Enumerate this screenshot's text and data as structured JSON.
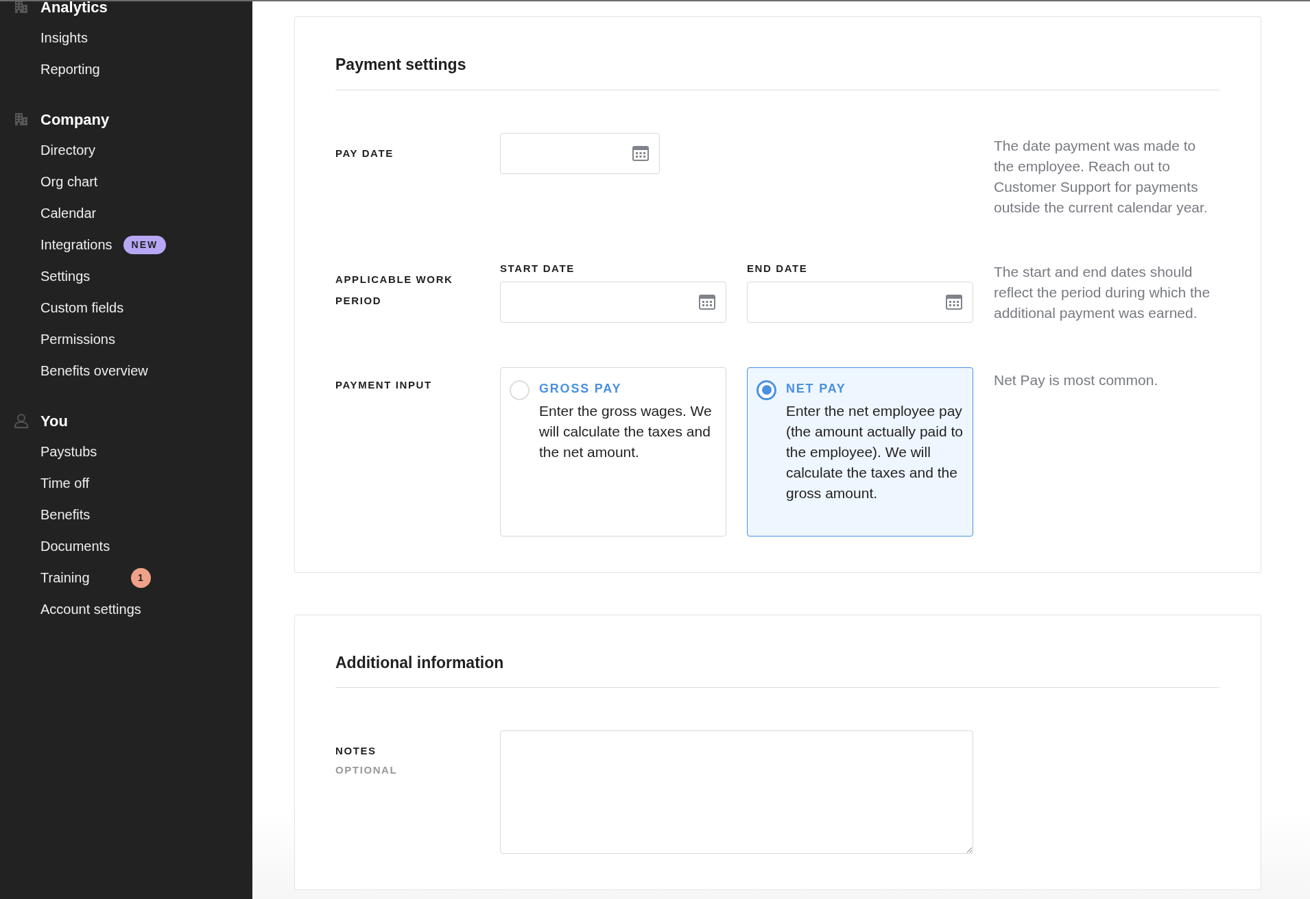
{
  "sidebar": {
    "sections": [
      {
        "title": "Analytics",
        "kind": "building",
        "items": [
          {
            "label": "Insights"
          },
          {
            "label": "Reporting"
          }
        ]
      },
      {
        "title": "Company",
        "kind": "building",
        "items": [
          {
            "label": "Directory"
          },
          {
            "label": "Org chart"
          },
          {
            "label": "Calendar"
          },
          {
            "label": "Integrations",
            "badge": "NEW"
          },
          {
            "label": "Settings"
          },
          {
            "label": "Custom fields"
          },
          {
            "label": "Permissions"
          },
          {
            "label": "Benefits overview"
          }
        ]
      },
      {
        "title": "You",
        "kind": "person",
        "items": [
          {
            "label": "Paystubs"
          },
          {
            "label": "Time off"
          },
          {
            "label": "Benefits"
          },
          {
            "label": "Documents"
          },
          {
            "label": "Training",
            "count": "1"
          },
          {
            "label": "Account settings"
          }
        ]
      }
    ]
  },
  "cards": [
    {
      "title": "Payment settings",
      "rows": [
        {
          "kind": "date",
          "label": "PAY DATE",
          "help": "The date payment was made to the employee. Reach out to Customer Support for payments outside the current calendar year."
        },
        {
          "kind": "range",
          "label": "APPLICABLE WORK PERIOD",
          "fields": [
            {
              "label": "START DATE"
            },
            {
              "label": "END DATE"
            }
          ],
          "help": "The start and end dates should reflect the period during which the additional payment was earned."
        },
        {
          "kind": "radio",
          "label": "PAYMENT INPUT",
          "options": [
            {
              "title": "GROSS PAY",
              "description": "Enter the gross wages. We will calculate the taxes and the net amount.",
              "selected": false
            },
            {
              "title": "NET PAY",
              "description": "Enter the net employee pay (the amount actually paid to the employee). We will calculate the taxes and the gross amount.",
              "selected": true
            }
          ],
          "help": "Net Pay is most common."
        }
      ]
    },
    {
      "title": "Additional information",
      "rows": [
        {
          "kind": "textarea",
          "label": "NOTES",
          "sublabel": "OPTIONAL"
        }
      ]
    }
  ]
}
